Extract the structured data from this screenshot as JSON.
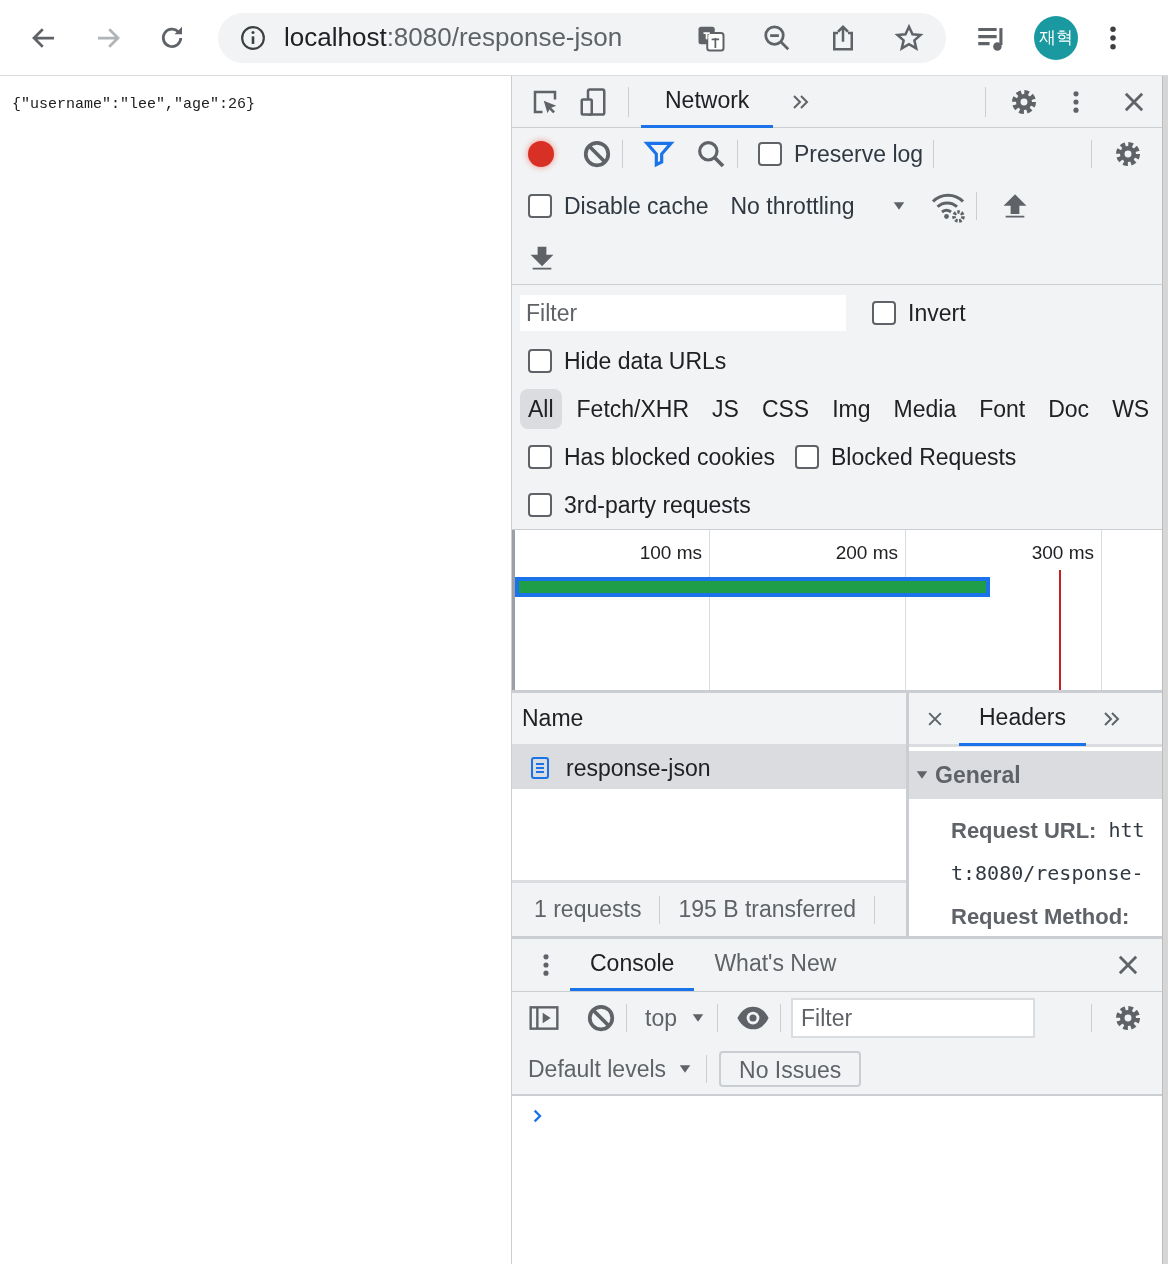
{
  "browser": {
    "nav": [
      {
        "kind": "back",
        "disabled": false
      },
      {
        "kind": "forward",
        "disabled": true
      },
      {
        "kind": "reload",
        "disabled": false
      }
    ],
    "address": {
      "host": "localhost",
      "path": ":8080/response-json"
    },
    "profile": {
      "initials": "재혁"
    }
  },
  "page": {
    "body": "{\"username\":\"lee\",\"age\":26}"
  },
  "devtools": {
    "panel_tabs": [
      {
        "label": "Network",
        "selected": true
      }
    ],
    "toolbar": {
      "recording": true,
      "preserve_log": {
        "label": "Preserve log",
        "checked": false
      },
      "disable_cache": {
        "label": "Disable cache",
        "checked": false
      },
      "throttling": "No throttling"
    },
    "filter": {
      "placeholder": "Filter",
      "invert": {
        "label": "Invert",
        "checked": false
      },
      "hide_data_urls": {
        "label": "Hide data URLs",
        "checked": false
      }
    },
    "types": [
      {
        "label": "All",
        "selected": true
      },
      {
        "label": "Fetch/XHR",
        "selected": false
      },
      {
        "label": "JS",
        "selected": false
      },
      {
        "label": "CSS",
        "selected": false
      },
      {
        "label": "Img",
        "selected": false
      },
      {
        "label": "Media",
        "selected": false
      },
      {
        "label": "Font",
        "selected": false
      },
      {
        "label": "Doc",
        "selected": false
      },
      {
        "label": "WS",
        "selected": false
      }
    ],
    "extra_filters": [
      {
        "label": "Has blocked cookies",
        "checked": false
      },
      {
        "label": "Blocked Requests",
        "checked": false
      },
      {
        "label": "3rd-party requests",
        "checked": false
      }
    ],
    "overview": {
      "ticks": [
        "100 ms",
        "200 ms",
        "300 ms"
      ]
    },
    "requests": {
      "column": "Name",
      "rows": [
        {
          "name": "response-json",
          "selected": true
        }
      ],
      "status": [
        "1 requests",
        "195 B transferred"
      ]
    },
    "details": {
      "tabs": [
        {
          "label": "Headers",
          "selected": true
        }
      ],
      "section": {
        "title": "General",
        "expanded": true
      },
      "fields": [
        {
          "label": "Request URL:",
          "value_lines": [
            "htt",
            "t:8080/response-"
          ]
        },
        {
          "label": "Request Method:"
        }
      ]
    },
    "drawer": {
      "tabs": [
        {
          "label": "Console",
          "selected": true
        },
        {
          "label": "What's New",
          "selected": false
        }
      ],
      "context": "top",
      "filter_placeholder": "Filter",
      "levels": "Default levels",
      "issues": "No Issues"
    }
  }
}
